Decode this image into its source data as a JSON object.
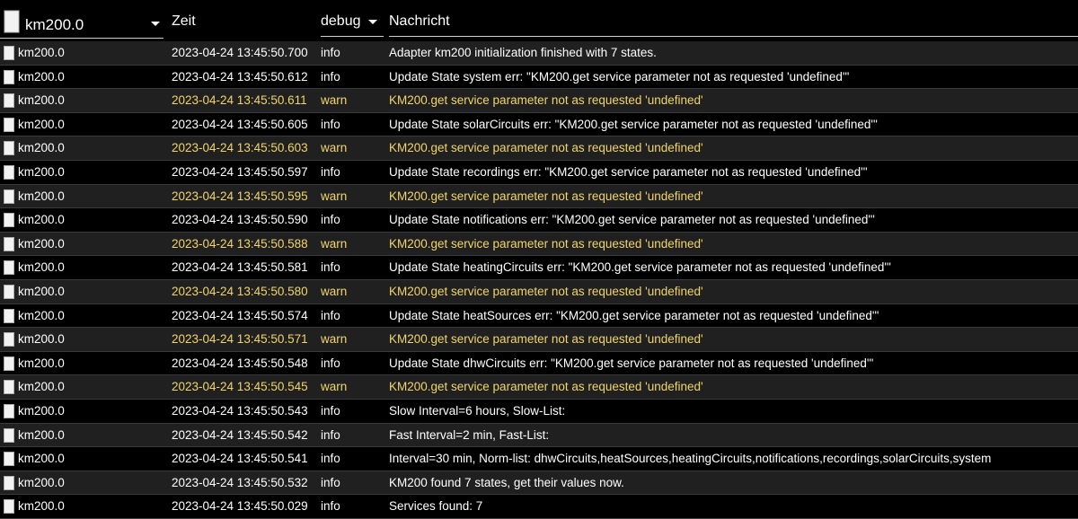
{
  "header": {
    "source_label": "km200.0",
    "time_label": "Zeit",
    "level_label": "debug",
    "message_label": "Nachricht"
  },
  "colors": {
    "warn": "#f1d56a",
    "info": "#ffffff",
    "row_alt": "#202020"
  },
  "icons": {
    "source": "document-icon",
    "dropdown": "chevron-down-icon"
  },
  "rows": [
    {
      "source": "km200.0",
      "time": "2023-04-24 13:45:50.700",
      "level": "info",
      "message": "Adapter km200 initialization finished with 7 states."
    },
    {
      "source": "km200.0",
      "time": "2023-04-24 13:45:50.612",
      "level": "info",
      "message": "Update State system err: \"KM200.get service parameter not as requested 'undefined'\""
    },
    {
      "source": "km200.0",
      "time": "2023-04-24 13:45:50.611",
      "level": "warn",
      "message": "KM200.get service parameter not as requested 'undefined'"
    },
    {
      "source": "km200.0",
      "time": "2023-04-24 13:45:50.605",
      "level": "info",
      "message": "Update State solarCircuits err: \"KM200.get service parameter not as requested 'undefined'\""
    },
    {
      "source": "km200.0",
      "time": "2023-04-24 13:45:50.603",
      "level": "warn",
      "message": "KM200.get service parameter not as requested 'undefined'"
    },
    {
      "source": "km200.0",
      "time": "2023-04-24 13:45:50.597",
      "level": "info",
      "message": "Update State recordings err: \"KM200.get service parameter not as requested 'undefined'\""
    },
    {
      "source": "km200.0",
      "time": "2023-04-24 13:45:50.595",
      "level": "warn",
      "message": "KM200.get service parameter not as requested 'undefined'"
    },
    {
      "source": "km200.0",
      "time": "2023-04-24 13:45:50.590",
      "level": "info",
      "message": "Update State notifications err: \"KM200.get service parameter not as requested 'undefined'\""
    },
    {
      "source": "km200.0",
      "time": "2023-04-24 13:45:50.588",
      "level": "warn",
      "message": "KM200.get service parameter not as requested 'undefined'"
    },
    {
      "source": "km200.0",
      "time": "2023-04-24 13:45:50.581",
      "level": "info",
      "message": "Update State heatingCircuits err: \"KM200.get service parameter not as requested 'undefined'\""
    },
    {
      "source": "km200.0",
      "time": "2023-04-24 13:45:50.580",
      "level": "warn",
      "message": "KM200.get service parameter not as requested 'undefined'"
    },
    {
      "source": "km200.0",
      "time": "2023-04-24 13:45:50.574",
      "level": "info",
      "message": "Update State heatSources err: \"KM200.get service parameter not as requested 'undefined'\""
    },
    {
      "source": "km200.0",
      "time": "2023-04-24 13:45:50.571",
      "level": "warn",
      "message": "KM200.get service parameter not as requested 'undefined'"
    },
    {
      "source": "km200.0",
      "time": "2023-04-24 13:45:50.548",
      "level": "info",
      "message": "Update State dhwCircuits err: \"KM200.get service parameter not as requested 'undefined'\""
    },
    {
      "source": "km200.0",
      "time": "2023-04-24 13:45:50.545",
      "level": "warn",
      "message": "KM200.get service parameter not as requested 'undefined'"
    },
    {
      "source": "km200.0",
      "time": "2023-04-24 13:45:50.543",
      "level": "info",
      "message": "Slow Interval=6 hours, Slow-List:"
    },
    {
      "source": "km200.0",
      "time": "2023-04-24 13:45:50.542",
      "level": "info",
      "message": "Fast Interval=2 min, Fast-List:"
    },
    {
      "source": "km200.0",
      "time": "2023-04-24 13:45:50.541",
      "level": "info",
      "message": "Interval=30 min, Norm-list: dhwCircuits,heatSources,heatingCircuits,notifications,recordings,solarCircuits,system"
    },
    {
      "source": "km200.0",
      "time": "2023-04-24 13:45:50.532",
      "level": "info",
      "message": "KM200 found 7 states, get their values now."
    },
    {
      "source": "km200.0",
      "time": "2023-04-24 13:45:50.029",
      "level": "info",
      "message": "Services found: 7"
    }
  ]
}
